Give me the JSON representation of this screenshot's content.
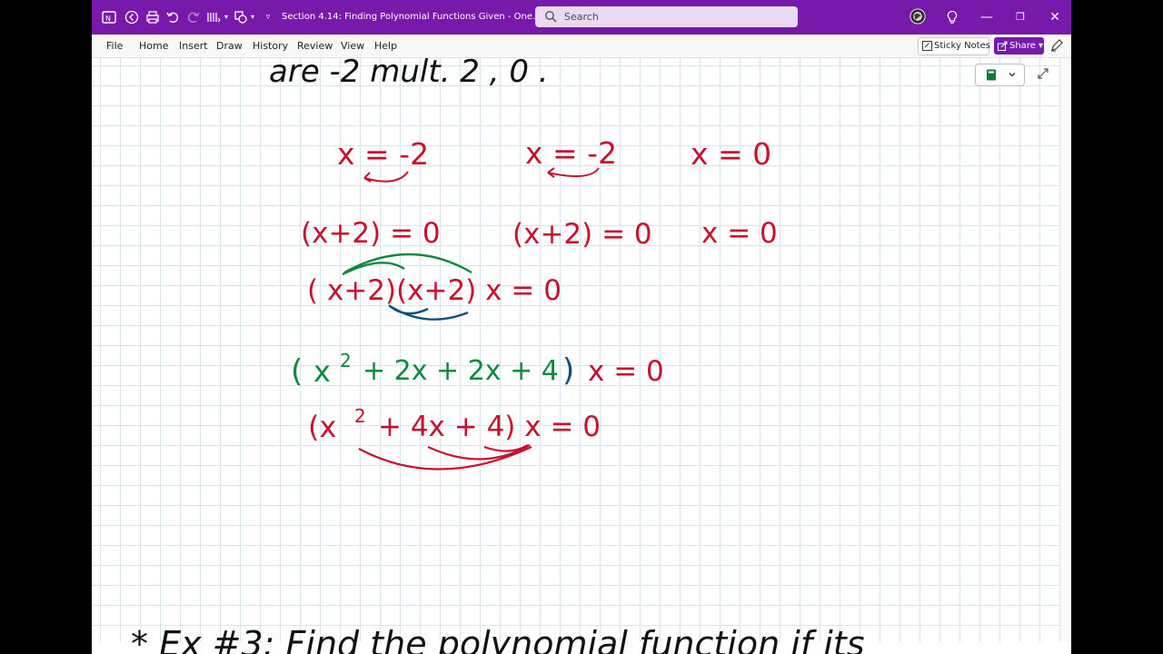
{
  "titlebar": {
    "doc_title": "Section 4.14:  Finding Polynomial Functions Given   -  One...",
    "search_placeholder": "Search",
    "minimize_glyph": "—",
    "restore_glyph": "❐",
    "close_glyph": "✕"
  },
  "menu": {
    "items": [
      "File",
      "Home",
      "Insert",
      "Draw",
      "History",
      "Review",
      "View",
      "Help"
    ],
    "sticky_notes": "Sticky Notes",
    "share": "Share"
  },
  "notes": {
    "top_line": "are  -2  mult.  2 ,  0 .",
    "row1": [
      "x = -2",
      "x = -2",
      "x = 0"
    ],
    "row2": [
      "(x+2) = 0",
      "(x+2) = 0",
      "x = 0"
    ],
    "row3": "( x+2)(x+2)  x  = 0",
    "row4": {
      "open": "(",
      "x": "x",
      "exp": "2",
      "terms": "+ 2x  + 2x  + 4",
      "close": ")",
      "tail": "x  =  0"
    },
    "row5": {
      "open": "(x",
      "exp": "2",
      "terms": "+ 4x  + 4)  x  =  0"
    },
    "bottom_partial": "* Ex #3:  Find  the  polynomial  function  if  its"
  },
  "colors": {
    "brand": "#7719aa",
    "ink_black": "#111111",
    "ink_red": "#c8102e",
    "ink_green": "#0e8a3e",
    "ink_blue": "#0d4f7c"
  }
}
